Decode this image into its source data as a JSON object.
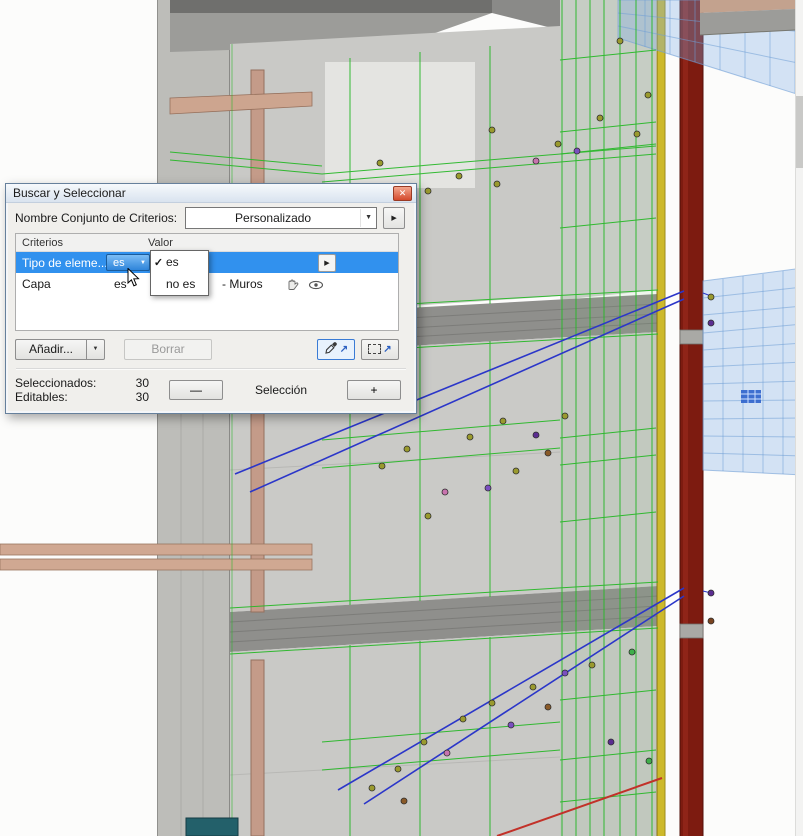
{
  "scene": {
    "colors": {
      "selection_green": "#29b829",
      "red_wall": "#7d1b10",
      "strip_yellow": "#cdb92b",
      "grid_plane_blue": "#7daae6",
      "guide_line_blue": "#2b36c9"
    }
  },
  "dialog": {
    "title": "Buscar y Seleccionar",
    "criteria_set": {
      "label": "Nombre Conjunto de Criterios:",
      "value": "Personalizado"
    },
    "table": {
      "headers": [
        "Criterios",
        "Valor"
      ],
      "rows": [
        {
          "criterion": "Tipo de eleme...",
          "relation": "es",
          "value": ""
        },
        {
          "criterion": "Capa",
          "relation": "es",
          "value": "- Muros"
        }
      ]
    },
    "relation_menu": {
      "items": [
        {
          "label": "es",
          "checked": true
        },
        {
          "label": "no es",
          "checked": false
        }
      ]
    },
    "buttons": {
      "add": "Añadir...",
      "delete": "Borrar"
    },
    "footer": {
      "selected_label": "Seleccionados:",
      "selected_value": "30",
      "editable_label": "Editables:",
      "editable_value": "30",
      "minus": "—",
      "selection_label": "Selección",
      "plus": "+"
    }
  },
  "icons": {
    "close": "✕",
    "combo_arrow": "▼",
    "play": "▶",
    "check": "✓",
    "ne_arrow": "↗"
  }
}
